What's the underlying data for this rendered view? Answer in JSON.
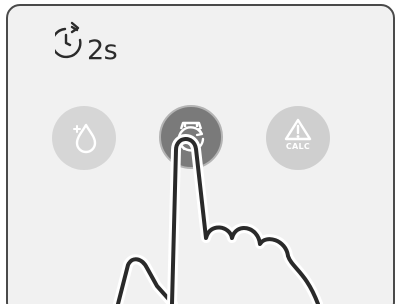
{
  "timer": {
    "duration_label": "2s",
    "icon": "stopwatch-arrow-icon"
  },
  "buttons": [
    {
      "name": "rinse-button",
      "icon": "droplet-sparkle-icon",
      "state": "idle"
    },
    {
      "name": "descale-button",
      "icon": "cycle-arrows-icon",
      "state": "pressed"
    },
    {
      "name": "calc-warning-button",
      "icon": "warning-triangle-icon",
      "label": "CALC",
      "state": "idle"
    }
  ],
  "gesture": {
    "icon": "pointing-hand-icon",
    "action": "press-and-hold"
  },
  "colors": {
    "panel_bg": "#f1f1f1",
    "panel_border": "#4a4a4a",
    "button_idle": "#d6d6d6",
    "button_pressed": "#7a7a7a",
    "icon_stroke": "#ffffff",
    "hand_stroke": "#2a2a2a"
  }
}
